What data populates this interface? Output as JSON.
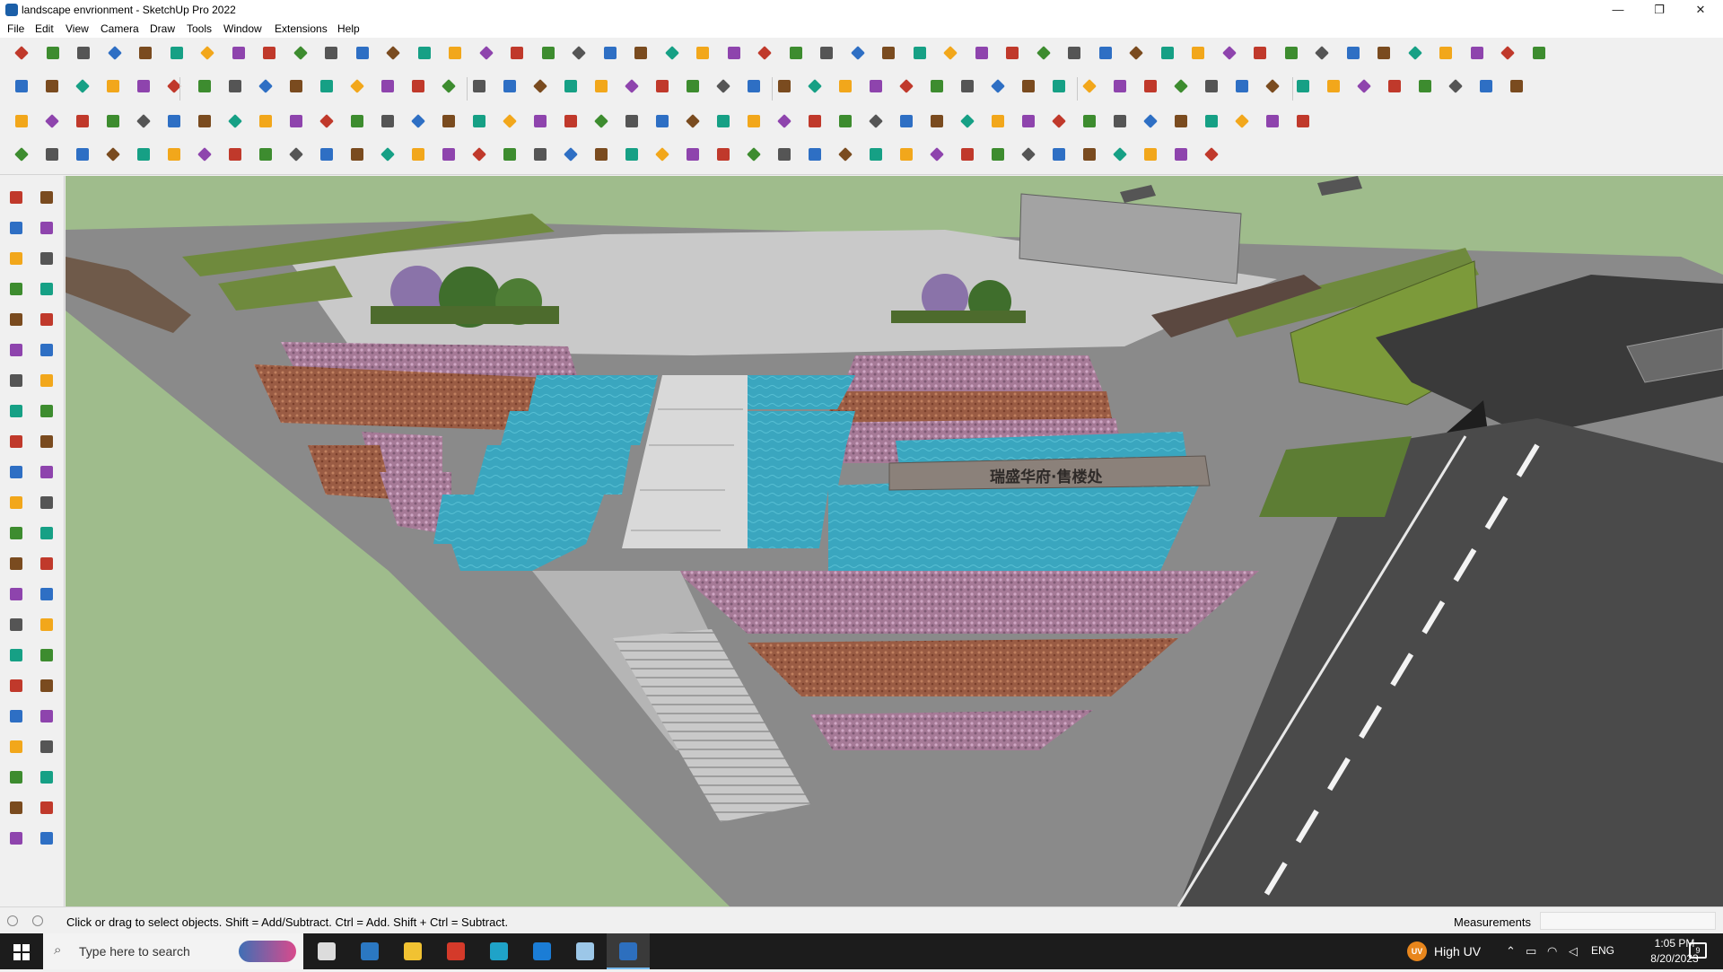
{
  "window": {
    "title": "landscape envrionment - SketchUp Pro 2022",
    "minimize": "—",
    "restore": "❐",
    "close": "✕"
  },
  "menu": [
    "File",
    "Edit",
    "View",
    "Camera",
    "Draw",
    "Tools",
    "Window",
    "Extensions",
    "Help"
  ],
  "toolbar_icons": {
    "palette": [
      "#c0392b",
      "#2e6fc4",
      "#f2a71b",
      "#3d8c2f",
      "#7a4b1f",
      "#8e44ad",
      "#555555",
      "#16a085"
    ]
  },
  "viewport": {
    "sign_text": "瑞盛华府·售楼处",
    "scene": "3D landscape model"
  },
  "status": {
    "hint": "Click or drag to select objects. Shift = Add/Subtract. Ctrl = Add. Shift + Ctrl = Subtract.",
    "measurements_label": "Measurements",
    "measurements_value": ""
  },
  "taskbar": {
    "search_placeholder": "Type here to search",
    "weather": "High UV",
    "weather_badge": "UV",
    "language": "ENG",
    "time": "1:05 PM",
    "date": "8/20/2023",
    "notifications": "9"
  }
}
